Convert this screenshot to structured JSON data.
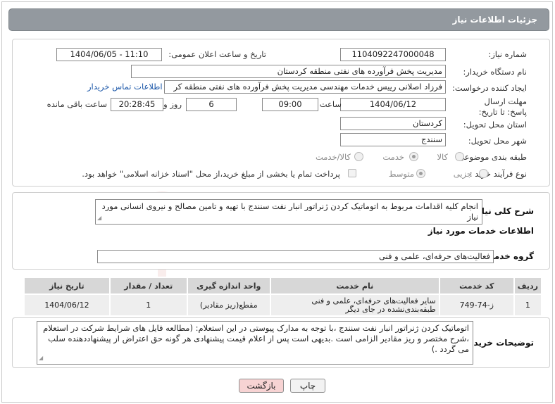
{
  "header": {
    "title": "جزئیات اطلاعات نیاز"
  },
  "fields": {
    "need_number_label": "شماره نیاز:",
    "need_number": "1104092247000048",
    "announce_datetime_label": "تاریخ و ساعت اعلان عمومی:",
    "announce_datetime": "1404/06/05 - 11:10",
    "buyer_org_label": "نام دستگاه خریدار:",
    "buyer_org": "مدیریت پخش فرآورده های نفتی منطقه کردستان",
    "requester_label": "ایجاد کننده درخواست:",
    "requester": "فرزاد اصلانی رییس خدمات مهندسی مدیریت پخش فرآورده های نفتی منطقه کر",
    "buyer_contact_link": "اطلاعات تماس خریدار",
    "deadline_label": "مهلت ارسال پاسخ: تا تاریخ:",
    "deadline_date": "1404/06/12",
    "time_label": "ساعت",
    "deadline_time": "09:00",
    "days_value": "6",
    "days_label": "روز و",
    "remaining_time": "20:28:45",
    "remaining_label": "ساعت باقی مانده",
    "province_label": "استان محل تحویل:",
    "province": "کردستان",
    "city_label": "شهر محل تحویل:",
    "city": "سنندج",
    "category_label": "طبقه بندی موضوعی:",
    "category_options": [
      "کالا",
      "خدمت",
      "کالا/خدمت"
    ],
    "category_selected": "خدمت",
    "process_label": "نوع فرآیند خرید :",
    "process_options": [
      "جزیی",
      "متوسط"
    ],
    "process_selected": "متوسط",
    "payment_note": "پرداخت تمام یا بخشی از مبلغ خرید،از محل \"اسناد خزانه اسلامی\" خواهد بود."
  },
  "summary": {
    "label": "شرح کلی نیاز:",
    "text": "انجام کلیه اقدامات مربوط به اتوماتیک کردن ژنراتور انبار نفت سنندج با تهیه و تامین مصالح و نیروی انسانی مورد نیاز"
  },
  "services": {
    "title": "اطلاعات خدمات مورد نیاز",
    "group_label": "گروه خدمت:",
    "group_value": "فعالیت‌های حرفه‌ای، علمی و فنی"
  },
  "table": {
    "headers": [
      "ردیف",
      "کد خدمت",
      "نام خدمت",
      "واحد اندازه گیری",
      "تعداد / مقدار",
      "تاریخ نیاز"
    ],
    "rows": [
      [
        "1",
        "ز-74-749",
        "سایر فعالیت‌های حرفه‌ای، علمی و فنی طبقه‌بندی‌نشده در جای دیگر",
        "مقطع(ریز مقادیر)",
        "1",
        "1404/06/12"
      ]
    ]
  },
  "buyer_notes": {
    "label": "توضیحات خریدار:",
    "text": "اتوماتیک کردن ژنراتور انبار نفت سنندج ،با توجه به مدارک پیوستی در این استعلام: (مطالعه فایل های شرایط شرکت در استعلام ،شرح مختصر و ریز مقادیر  الزامی است .بدیهی است پس از اعلام قیمت پیشنهادی هر گونه حق اعتراض از پیشنهاددهنده سلب می گردد .)"
  },
  "buttons": {
    "print": "چاپ",
    "back": "بازگشت"
  },
  "watermark": {
    "text": "AriaTender.neT"
  },
  "colors": {
    "header_bg": "#93999f",
    "back_button_bg": "#f7d3d3",
    "print_button_bg": "#f2f2f2",
    "link": "#1a56a8"
  }
}
